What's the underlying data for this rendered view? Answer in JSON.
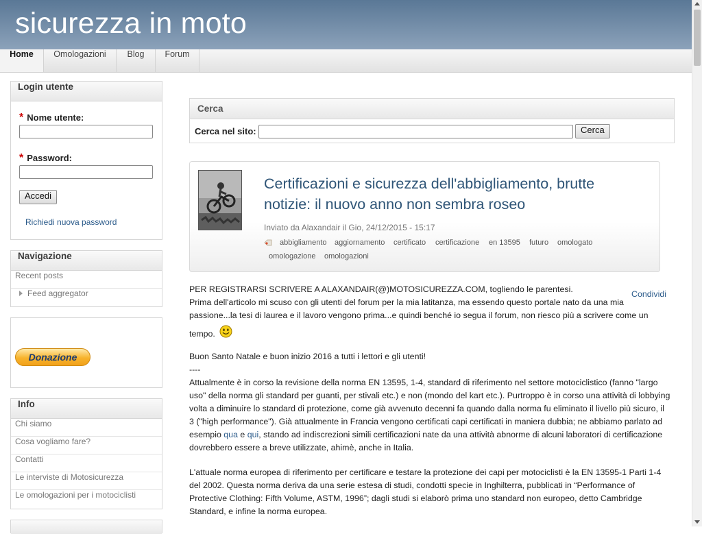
{
  "site": {
    "name": "sicurezza in moto"
  },
  "nav": {
    "tabs": [
      "Home",
      "Omologazioni",
      "Blog",
      "Forum"
    ]
  },
  "login": {
    "title": "Login utente",
    "required_mark": "*",
    "username_label": "Nome utente:",
    "username_value": "",
    "password_label": "Password:",
    "password_value": "",
    "submit": "Accedi",
    "new_password": "Richiedi nuova password"
  },
  "navigation": {
    "title": "Navigazione",
    "items": [
      "Recent posts",
      "Feed aggregator"
    ]
  },
  "donate": {
    "label": "Donazione"
  },
  "info": {
    "title": "Info",
    "items": [
      "Chi siamo",
      "Cosa vogliamo fare?",
      "Contatti",
      "Le interviste di Motosicurezza",
      "Le omologazioni per i motociclisti"
    ]
  },
  "search": {
    "title": "Cerca",
    "label": "Cerca nel sito:",
    "value": "",
    "button": "Cerca"
  },
  "article": {
    "title_lines": [
      "Certificazioni e sicurezza dell'abbigliamento, brutte",
      "notizie: il nuovo anno non sembra roseo"
    ],
    "byline": "Inviato da Alaxandair il Gio, 24/12/2015 - 15:17",
    "tags": [
      "abbigliamento",
      "aggiornamento",
      "certificato",
      "certificazione",
      "en 13595",
      "futuro",
      "omologato",
      "omologazione",
      "omologazioni"
    ],
    "share": "Condividi"
  },
  "body": {
    "p1": [
      "PER REGISTRARSI SCRIVERE A ALAXANDAIR(@)MOTOSICUREZZA.COM, togliendo le parentesi.",
      "Prima dell'articolo mi scuso con gli utenti del forum per la mia latitanza, ma essendo questo portale nato da una mia",
      "passione...la tesi di laurea e il lavoro vengono prima...e quindi benché io segua il forum, non riesco più a scrivere come un",
      "tempo."
    ],
    "p2": [
      "Buon Santo Natale e buon inizio 2016 a tutti i lettori e gli utenti!",
      "----",
      "Attualmente è in corso la revisione della norma EN 13595, 1-4, standard di riferimento nel settore motociclistico (fanno \"largo",
      "uso\" della norma gli standard per guanti, per stivali etc.) e non (mondo del kart etc.). Purtroppo è in corso una attività di lobbying",
      "volta a diminuire lo standard di protezione, come già avvenuto decenni fa quando dalla norma fu eliminato il livello più sicuro, il",
      "3 (\"high performance\"). Già attualmente in Francia vengono certificati capi certificati in maniera dubbia; ne abbiamo parlato ad"
    ],
    "p2_last": {
      "before": "esempio ",
      "link1": "qua",
      "mid": " e ",
      "link2": "qui",
      "after": ", stando ad indiscrezioni simili certificazioni nate da una attività abnorme di alcuni laboratori di certificazione"
    },
    "p2_end": "dovrebbero essere a breve utilizzate, ahimè, anche in Italia.",
    "p3": [
      "L'attuale norma europea di riferimento per certificare e testare la protezione dei capi per motociclisti è la EN 13595-1 Parti 1-4",
      "del 2002. Questa norma deriva da una serie estesa di studi, condotti specie in Inghilterra, pubblicati in “Performance of",
      "Protective Clothing: Fifth Volume, ASTM, 1996”; dagli studi si elaborò prima uno standard non europeo, detto Cambridge",
      "Standard, e infine la norma europea."
    ]
  }
}
